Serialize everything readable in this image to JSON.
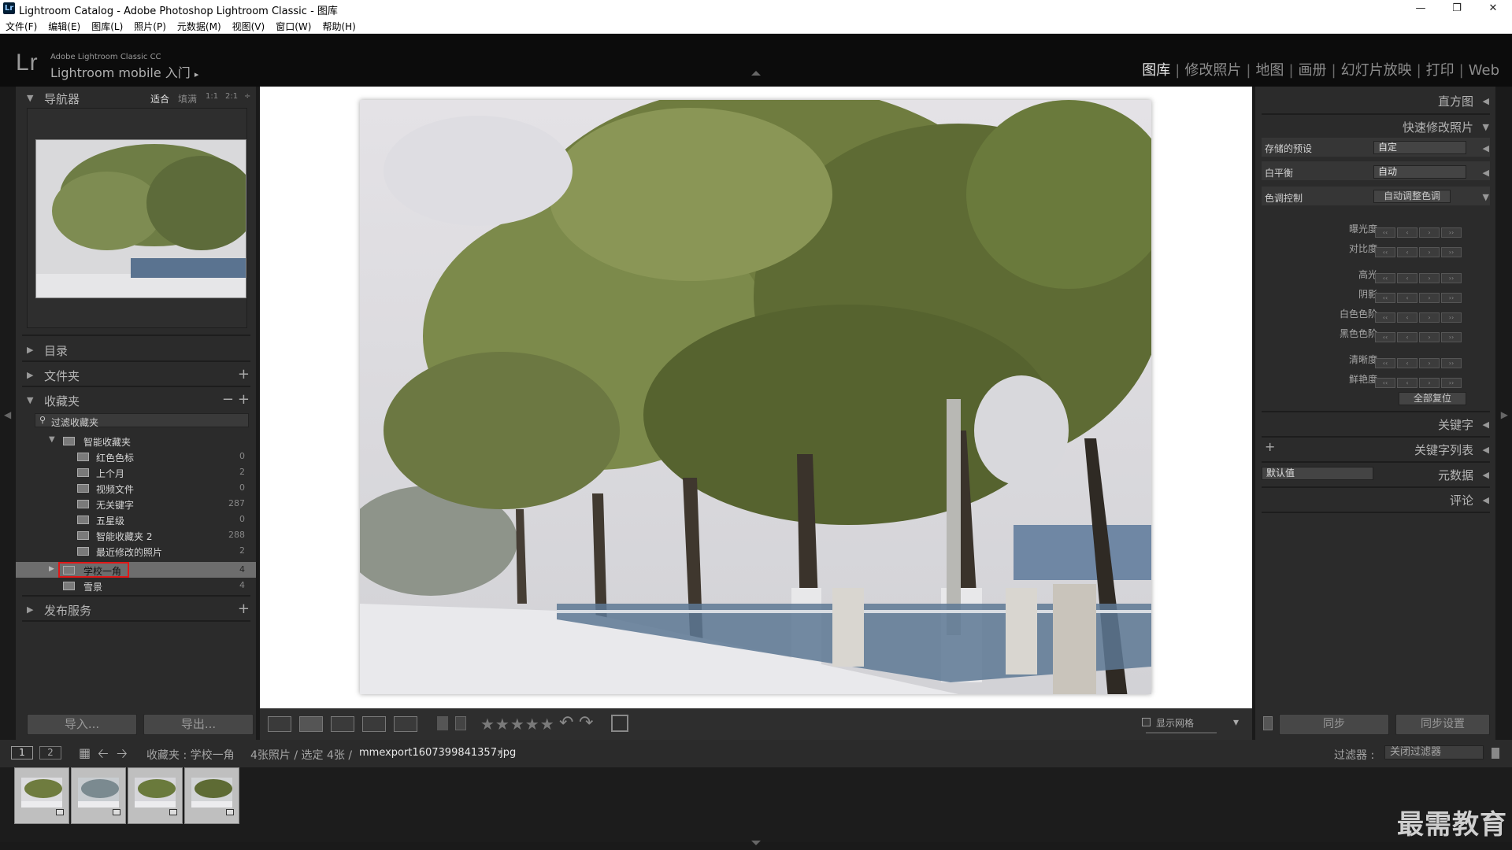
{
  "window": {
    "title": "Lightroom Catalog - Adobe Photoshop Lightroom Classic - 图库",
    "app_badge": "Lr",
    "minimize": "—",
    "maximize": "❐",
    "close": "✕"
  },
  "menubar": {
    "items": [
      "文件(F)",
      "编辑(E)",
      "图库(L)",
      "照片(P)",
      "元数据(M)",
      "视图(V)",
      "窗口(W)",
      "帮助(H)"
    ]
  },
  "identity": {
    "logo": "Lr",
    "line1": "Adobe Lightroom Classic CC",
    "line2": "Lightroom mobile 入门",
    "line2_arrow": "▸",
    "modules": [
      "图库",
      "修改照片",
      "地图",
      "画册",
      "幻灯片放映",
      "打印",
      "Web"
    ],
    "active_module": "图库",
    "sep": "|"
  },
  "left": {
    "navigator": {
      "title": "导航器",
      "zooms": [
        "适合",
        "填满",
        "1:1",
        "2:1"
      ],
      "zoom_more": "÷",
      "active_zoom": "适合"
    },
    "catalog": {
      "title": "目录"
    },
    "folders": {
      "title": "文件夹",
      "plus": "+"
    },
    "collections": {
      "title": "收藏夹",
      "minus": "−",
      "plus": "+",
      "filter_placeholder": "过滤收藏夹",
      "smart_set": "智能收藏夹",
      "items": [
        {
          "name": "红色色标",
          "count": "0"
        },
        {
          "name": "上个月",
          "count": "2"
        },
        {
          "name": "视频文件",
          "count": "0"
        },
        {
          "name": "无关键字",
          "count": "287"
        },
        {
          "name": "五星级",
          "count": "0"
        },
        {
          "name": "智能收藏夹 2",
          "count": "288"
        },
        {
          "name": "最近修改的照片",
          "count": "2"
        }
      ],
      "selected": {
        "name": "学校一角",
        "count": "4"
      },
      "other": {
        "name": "雪景",
        "count": "4"
      }
    },
    "publish": {
      "title": "发布服务",
      "plus": "+"
    },
    "import_label": "导入...",
    "export_label": "导出..."
  },
  "toolbar": {
    "stars": "★★★★★",
    "show_grid": "显示网格",
    "dropdown": "▾"
  },
  "right": {
    "histogram": "直方图",
    "quick_develop": "快速修改照片",
    "saved_preset_label": "存储的预设",
    "saved_preset_value": "自定",
    "wb_label": "白平衡",
    "wb_value": "自动",
    "tone_label": "色调控制",
    "auto_tone": "自动调整色调",
    "rows": [
      "曝光度",
      "对比度",
      "高光",
      "阴影",
      "白色色阶",
      "黑色色阶",
      "清晰度",
      "鲜艳度"
    ],
    "reset_all": "全部复位",
    "keywording": "关键字",
    "keyword_list": "关键字列表",
    "keyword_plus": "+",
    "metadata": "元数据",
    "metadata_preset": "默认值",
    "comments": "评论",
    "sync": "同步",
    "sync_settings": "同步设置",
    "stepper_glyphs": [
      "‹‹",
      "‹",
      "›",
      "››"
    ]
  },
  "filmstrip": {
    "screen1": "1",
    "screen2": "2",
    "source_label": "收藏夹 : 学校一角",
    "count_text": "4张照片 / 选定 4张 /",
    "filename": "mmexport1607399841357.jpg",
    "filename_arrow": "▾",
    "filter_label": "过滤器 :",
    "filter_value": "关闭过滤器",
    "thumb_count": 4
  },
  "watermark": "最需教育"
}
